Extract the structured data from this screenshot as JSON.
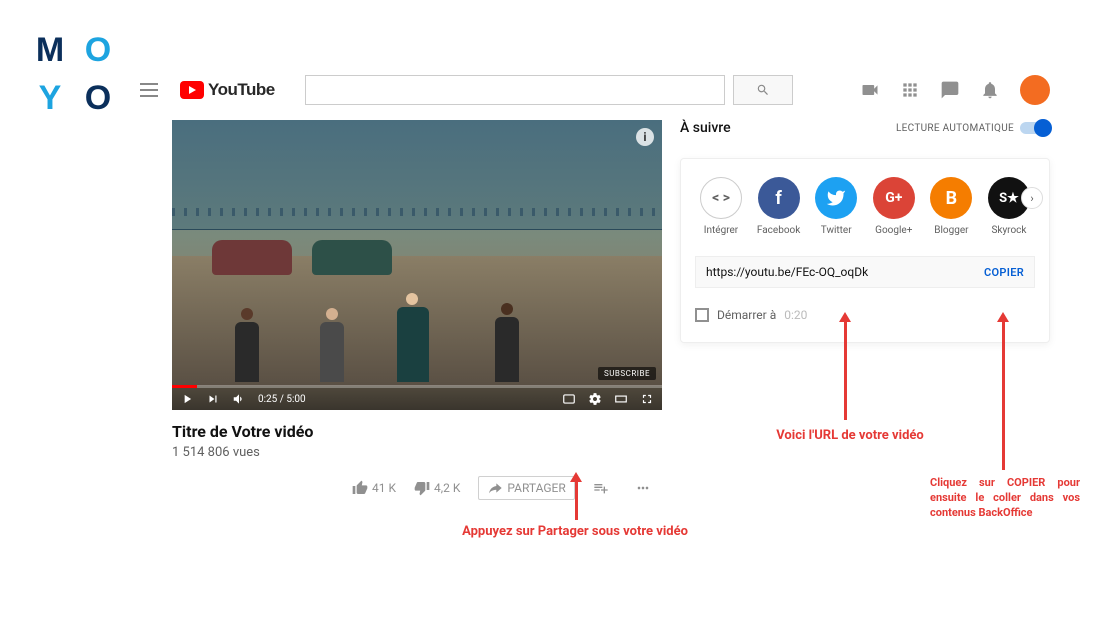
{
  "moyo": {
    "m": "M",
    "o1": "O",
    "y": "Y",
    "o2": "O"
  },
  "header": {
    "logo_text": "YouTube",
    "search_placeholder": "",
    "icons": {
      "video": "camera",
      "apps": "apps",
      "messages": "chat",
      "notifications": "bell",
      "avatar": "user-avatar"
    }
  },
  "player": {
    "info": "i",
    "subscribe": "SUBSCRIBE",
    "time": "0:25 / 5:00"
  },
  "video": {
    "title": "Titre de Votre vidéo",
    "views": "1 514 806 vues",
    "likes": "41 K",
    "dislikes": "4,2 K",
    "share": "PARTAGER"
  },
  "sidebar": {
    "upnext": "À suivre",
    "autoplay": "LECTURE AUTOMATIQUE"
  },
  "share_panel": {
    "embed": "Intégrer",
    "embed_symbol": "< >",
    "facebook": "Facebook",
    "facebook_symbol": "f",
    "twitter": "Twitter",
    "google": "Google+",
    "google_symbol": "G+",
    "blogger": "Blogger",
    "blogger_symbol": "B",
    "skyrock": "Skyrock",
    "skyrock_symbol": "S★",
    "url": "https://youtu.be/FEc-OQ_oqDk",
    "copy": "COPIER",
    "start_at": "Démarrer à",
    "start_time": "0:20",
    "next_arrow": "›"
  },
  "annotations": {
    "ann1": "Appuyez sur Partager sous votre vidéo",
    "ann2": "Voici l'URL de votre vidéo",
    "ann3": "Cliquez sur COPIER pour ensuite le coller dans vos contenus BackOffice"
  }
}
